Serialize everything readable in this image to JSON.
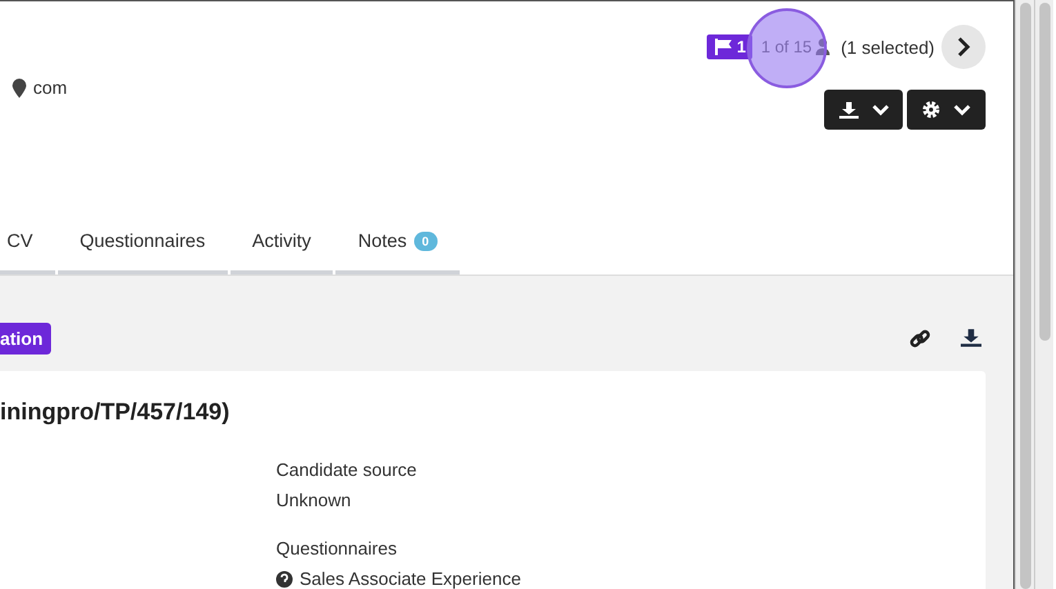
{
  "header": {
    "flag_count": "1",
    "position": "1 of 15",
    "selection": "(1 selected)",
    "location": "com"
  },
  "tabs": [
    {
      "label": "CV"
    },
    {
      "label": "Questionnaires"
    },
    {
      "label": "Activity"
    },
    {
      "label": "Notes",
      "badge": "0"
    }
  ],
  "section": {
    "tag": "ation",
    "title": "iningpro/TP/457/149)",
    "fields": [
      {
        "label": "Candidate source",
        "value": "Unknown"
      },
      {
        "label": "Questionnaires",
        "value": "Sales Associate Experience",
        "kind": "questionnaire"
      }
    ]
  }
}
